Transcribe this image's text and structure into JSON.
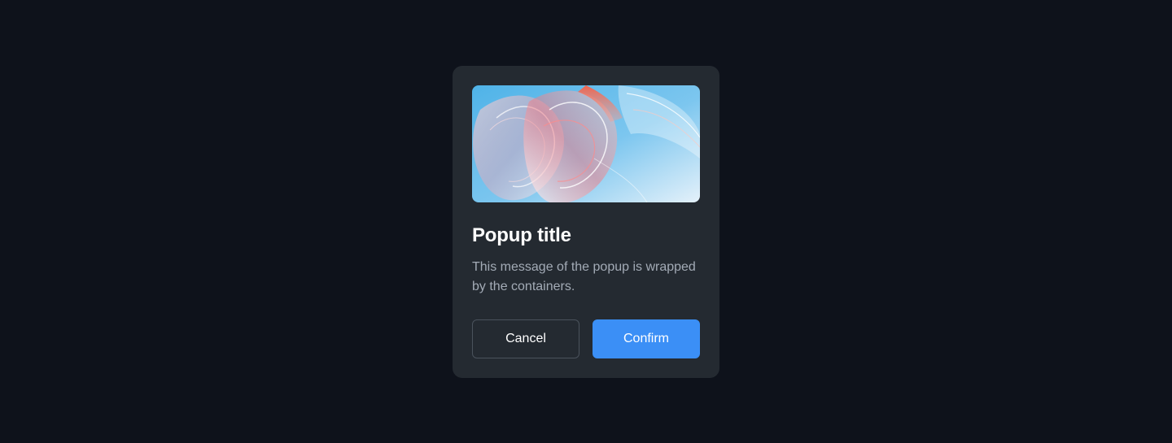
{
  "popup": {
    "image": {
      "icon": "abstract-glass-artwork",
      "colors": {
        "sky": "#5ab9ea",
        "sky_light": "#dfeff9",
        "accent": "#f35a4a"
      }
    },
    "title": "Popup title",
    "message": "This message of the popup is wrapped by the containers.",
    "cancel_label": "Cancel",
    "confirm_label": "Confirm"
  },
  "colors": {
    "background": "#0e121b",
    "card": "#242a31",
    "primary": "#3b8ff6",
    "text": "#ffffff",
    "muted_text": "#a3abb6"
  }
}
